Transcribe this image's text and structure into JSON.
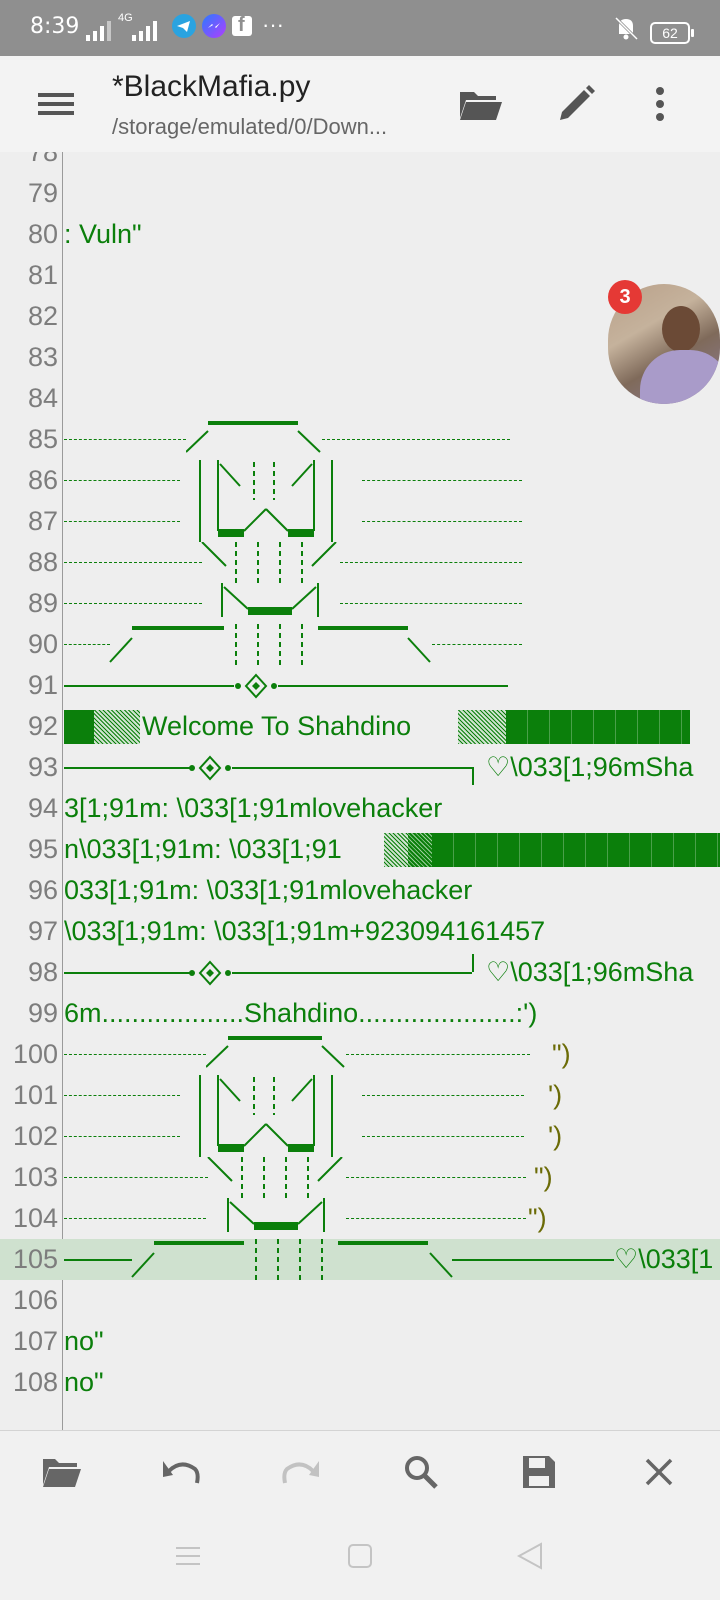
{
  "status_bar": {
    "time": "8:39",
    "network": "4G",
    "battery": "62",
    "more": "···",
    "icons": [
      "signal-icon",
      "telegram-icon",
      "messenger-icon",
      "facebook-icon",
      "mute-icon",
      "battery-icon"
    ]
  },
  "toolbar": {
    "title": "*BlackMafia.py",
    "path": "/storage/emulated/0/Down..."
  },
  "editor": {
    "lines": [
      {
        "n": "78",
        "text": ""
      },
      {
        "n": "79",
        "text": ""
      },
      {
        "n": "80",
        "text": ": Vuln\""
      },
      {
        "n": "81",
        "text": ""
      },
      {
        "n": "82",
        "text": ""
      },
      {
        "n": "83",
        "text": ""
      },
      {
        "n": "84",
        "text": ""
      },
      {
        "n": "85",
        "text": ""
      },
      {
        "n": "86",
        "text": ""
      },
      {
        "n": "87",
        "text": ""
      },
      {
        "n": "88",
        "text": ""
      },
      {
        "n": "89",
        "text": ""
      },
      {
        "n": "90",
        "text": ""
      },
      {
        "n": "91",
        "text": ""
      },
      {
        "n": "92",
        "text": "Welcome To Shahdino"
      },
      {
        "n": "93",
        "text": "♡\\033[1;96mSha"
      },
      {
        "n": "94",
        "text": "3[1;91m: \\033[1;91mlovehacker"
      },
      {
        "n": "95",
        "text": "n\\033[1;91m: \\033[1;91"
      },
      {
        "n": "96",
        "text": "033[1;91m: \\033[1;91mlovehacker"
      },
      {
        "n": "97",
        "text": "\\033[1;91m: \\033[1;91m+923094161457"
      },
      {
        "n": "98",
        "text": "♡\\033[1;96mSha"
      },
      {
        "n": "99",
        "text": "6m...................Shahdino.....................:')"
      },
      {
        "n": "100",
        "text": "\")"
      },
      {
        "n": "101",
        "text": "')"
      },
      {
        "n": "102",
        "text": "')"
      },
      {
        "n": "103",
        "text": "\")"
      },
      {
        "n": "104",
        "text": "\")"
      },
      {
        "n": "105",
        "text": "♡\\033[1"
      },
      {
        "n": "106",
        "text": ""
      },
      {
        "n": "107",
        "text": " no\""
      },
      {
        "n": "108",
        "text": "no\""
      }
    ]
  },
  "chat_head": {
    "badge": "3"
  },
  "bottom_toolbar": [
    "open-folder",
    "undo",
    "redo",
    "search",
    "save",
    "close"
  ]
}
